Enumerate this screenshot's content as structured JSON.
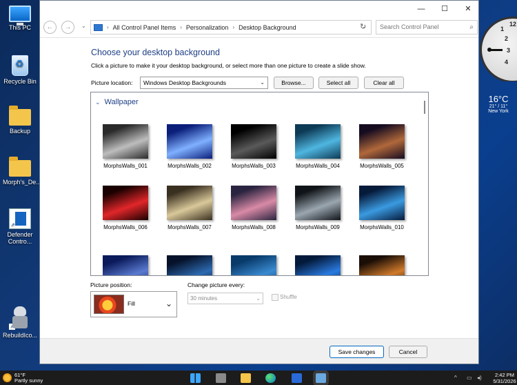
{
  "desktop": {
    "icons": [
      {
        "label": "This PC"
      },
      {
        "label": "Recycle Bin"
      },
      {
        "label": "Backup"
      },
      {
        "label": "Morph's_De..."
      },
      {
        "label": "Defender Contro..."
      },
      {
        "label": "RebuildIco..."
      }
    ],
    "clock_numbers": [
      "12",
      "1",
      "2",
      "3",
      "4"
    ],
    "weather": {
      "temp": "16°C",
      "range": "21° / 11°",
      "city": "New York"
    }
  },
  "window": {
    "controls": {
      "minimize": "—",
      "maximize": "☐",
      "close": "✕"
    },
    "nav": {
      "back": "←",
      "forward": "→",
      "recent": "⌄"
    },
    "breadcrumb": [
      "All Control Panel Items",
      "Personalization",
      "Desktop Background"
    ],
    "search_placeholder": "Search Control Panel",
    "heading": "Choose your desktop background",
    "instruction": "Click a picture to make it your desktop background, or select more than one picture to create a slide show.",
    "picture_location_label": "Picture location:",
    "picture_location_value": "Windows Desktop Backgrounds",
    "browse_label": "Browse...",
    "select_all_label": "Select all",
    "clear_all_label": "Clear all",
    "group_title": "Wallpaper",
    "wallpapers": [
      {
        "name": "MorphsWalls_001",
        "colors": [
          "#2a2a2a",
          "#bdbdbd"
        ]
      },
      {
        "name": "MorphsWalls_002",
        "colors": [
          "#0a1e7a",
          "#7fb0ff"
        ]
      },
      {
        "name": "MorphsWalls_003",
        "colors": [
          "#000000",
          "#5a5a5a"
        ]
      },
      {
        "name": "MorphsWalls_004",
        "colors": [
          "#0d3a55",
          "#4fb6e0"
        ]
      },
      {
        "name": "MorphsWalls_005",
        "colors": [
          "#160c20",
          "#b0683a"
        ]
      },
      {
        "name": "MorphsWalls_006",
        "colors": [
          "#1a0000",
          "#e0262a"
        ]
      },
      {
        "name": "MorphsWalls_007",
        "colors": [
          "#3a3020",
          "#d9c89a"
        ]
      },
      {
        "name": "MorphsWalls_008",
        "colors": [
          "#2a2440",
          "#d98aa6"
        ]
      },
      {
        "name": "MorphsWalls_009",
        "colors": [
          "#101418",
          "#9aa6b0"
        ]
      },
      {
        "name": "MorphsWalls_010",
        "colors": [
          "#061a3a",
          "#3a9ae0"
        ]
      },
      {
        "name": "",
        "colors": [
          "#0a1a5a",
          "#5a7ad0"
        ]
      },
      {
        "name": "",
        "colors": [
          "#06122a",
          "#2c6ab0"
        ]
      },
      {
        "name": "",
        "colors": [
          "#083a6a",
          "#3a8ad0"
        ]
      },
      {
        "name": "",
        "colors": [
          "#031a3a",
          "#2a7ae0"
        ]
      },
      {
        "name": "",
        "colors": [
          "#1a0e06",
          "#d07a2a"
        ]
      }
    ],
    "picture_position_label": "Picture position:",
    "picture_position_value": "Fill",
    "change_picture_label": "Change picture every:",
    "change_picture_value": "30 minutes",
    "shuffle_label": "Shuffle",
    "save_label": "Save changes",
    "cancel_label": "Cancel"
  },
  "taskbar": {
    "weather_temp": "61°F",
    "weather_desc": "Partly sunny",
    "time": "2:42 PM",
    "date": "5/31/2026"
  },
  "colors": {
    "accent": "#0067c0",
    "heading": "#1e3f86",
    "taskbar": "#1c1c1c"
  }
}
